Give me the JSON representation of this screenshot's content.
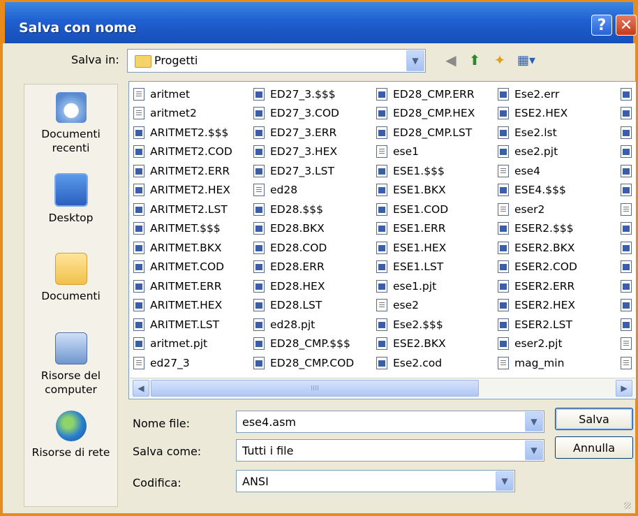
{
  "window": {
    "title": "Salva con nome"
  },
  "title_buttons": {
    "help": "?",
    "close": "✕"
  },
  "save_in": {
    "label": "Salva in:",
    "value": "Progetti"
  },
  "places": [
    {
      "label": "Documenti recenti",
      "icon": "recent-documents-icon"
    },
    {
      "label": "Desktop",
      "icon": "desktop-icon"
    },
    {
      "label": "Documenti",
      "icon": "documents-folder-icon"
    },
    {
      "label": "Risorse del computer",
      "icon": "my-computer-icon"
    },
    {
      "label": "Risorse di rete",
      "icon": "network-icon"
    }
  ],
  "files": {
    "col1": [
      {
        "name": "aritmet",
        "icon": "txt"
      },
      {
        "name": "aritmet2",
        "icon": "txt"
      },
      {
        "name": "ARITMET2.$$$",
        "icon": "exe"
      },
      {
        "name": "ARITMET2.COD",
        "icon": "exe"
      },
      {
        "name": "ARITMET2.ERR",
        "icon": "exe"
      },
      {
        "name": "ARITMET2.HEX",
        "icon": "exe"
      },
      {
        "name": "ARITMET2.LST",
        "icon": "exe"
      },
      {
        "name": "ARITMET.$$$",
        "icon": "exe"
      },
      {
        "name": "ARITMET.BKX",
        "icon": "exe"
      },
      {
        "name": "ARITMET.COD",
        "icon": "exe"
      },
      {
        "name": "ARITMET.ERR",
        "icon": "exe"
      },
      {
        "name": "ARITMET.HEX",
        "icon": "exe"
      },
      {
        "name": "ARITMET.LST",
        "icon": "exe"
      },
      {
        "name": "aritmet.pjt",
        "icon": "exe"
      },
      {
        "name": "ed27_3",
        "icon": "txt"
      }
    ],
    "col2": [
      {
        "name": "ED27_3.$$$",
        "icon": "exe"
      },
      {
        "name": "ED27_3.COD",
        "icon": "exe"
      },
      {
        "name": "ED27_3.ERR",
        "icon": "exe"
      },
      {
        "name": "ED27_3.HEX",
        "icon": "exe"
      },
      {
        "name": "ED27_3.LST",
        "icon": "exe"
      },
      {
        "name": "ed28",
        "icon": "txt"
      },
      {
        "name": "ED28.$$$",
        "icon": "exe"
      },
      {
        "name": "ED28.BKX",
        "icon": "exe"
      },
      {
        "name": "ED28.COD",
        "icon": "exe"
      },
      {
        "name": "ED28.ERR",
        "icon": "exe"
      },
      {
        "name": "ED28.HEX",
        "icon": "exe"
      },
      {
        "name": "ED28.LST",
        "icon": "exe"
      },
      {
        "name": "ed28.pjt",
        "icon": "exe"
      },
      {
        "name": "ED28_CMP.$$$",
        "icon": "exe"
      },
      {
        "name": "ED28_CMP.COD",
        "icon": "exe"
      }
    ],
    "col3": [
      {
        "name": "ED28_CMP.ERR",
        "icon": "exe"
      },
      {
        "name": "ED28_CMP.HEX",
        "icon": "exe"
      },
      {
        "name": "ED28_CMP.LST",
        "icon": "exe"
      },
      {
        "name": "ese1",
        "icon": "txt"
      },
      {
        "name": "ESE1.$$$",
        "icon": "exe"
      },
      {
        "name": "ESE1.BKX",
        "icon": "exe"
      },
      {
        "name": "ESE1.COD",
        "icon": "exe"
      },
      {
        "name": "ESE1.ERR",
        "icon": "exe"
      },
      {
        "name": "ESE1.HEX",
        "icon": "exe"
      },
      {
        "name": "ESE1.LST",
        "icon": "exe"
      },
      {
        "name": "ese1.pjt",
        "icon": "exe"
      },
      {
        "name": "ese2",
        "icon": "txt"
      },
      {
        "name": "Ese2.$$$",
        "icon": "exe"
      },
      {
        "name": "ESE2.BKX",
        "icon": "exe"
      },
      {
        "name": "Ese2.cod",
        "icon": "exe"
      }
    ],
    "col4": [
      {
        "name": "Ese2.err",
        "icon": "exe"
      },
      {
        "name": "ESE2.HEX",
        "icon": "exe"
      },
      {
        "name": "Ese2.lst",
        "icon": "exe"
      },
      {
        "name": "ese2.pjt",
        "icon": "exe"
      },
      {
        "name": "ese4",
        "icon": "txt"
      },
      {
        "name": "ESE4.$$$",
        "icon": "exe"
      },
      {
        "name": "eser2",
        "icon": "txt"
      },
      {
        "name": "ESER2.$$$",
        "icon": "exe"
      },
      {
        "name": "ESER2.BKX",
        "icon": "exe"
      },
      {
        "name": "ESER2.COD",
        "icon": "exe"
      },
      {
        "name": "ESER2.ERR",
        "icon": "exe"
      },
      {
        "name": "ESER2.HEX",
        "icon": "exe"
      },
      {
        "name": "ESER2.LST",
        "icon": "exe"
      },
      {
        "name": "eser2.pjt",
        "icon": "exe"
      },
      {
        "name": "mag_min",
        "icon": "txt"
      }
    ]
  },
  "form": {
    "filename_label": "Nome file:",
    "filename_value": "ese4.asm",
    "savetype_label": "Salva come:",
    "savetype_value": "Tutti i file",
    "encoding_label": "Codifica:",
    "encoding_value": "ANSI"
  },
  "buttons": {
    "save": "Salva",
    "cancel": "Annulla"
  },
  "scrollbar": {
    "thumb_grip": "IIII"
  }
}
